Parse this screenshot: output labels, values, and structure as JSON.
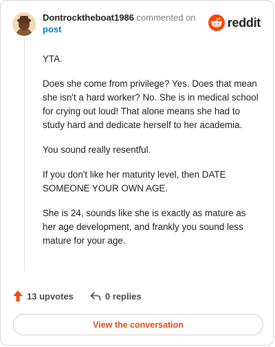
{
  "comment": {
    "username": "Dontrocktheboat1986",
    "commented_on": "commented on",
    "post_link": "post",
    "paragraphs": [
      "YTA.",
      "Does she come from privilege? Yes. Does that mean she isn't a hard worker? No. She is in medical school for crying out loud! That alone means she had to study hard and dedicate herself to her academia.",
      "You sound really resentful.",
      "If you don't like her maturity level, then DATE SOMEONE YOUR OWN AGE.",
      "She is 24, sounds like she is exactly as mature as her age development, and frankly you sound less mature for your age."
    ]
  },
  "brand": {
    "name": "reddit",
    "color": "#ff4500"
  },
  "actions": {
    "upvotes": "13 upvotes",
    "replies": "0 replies"
  },
  "cta": {
    "label": "View the conversation",
    "color": "#e34b12"
  },
  "icons": {
    "avatar": "avatar",
    "brand": "reddit-alien-icon",
    "upvote": "upvote-arrow-icon",
    "reply": "reply-arrow-icon"
  }
}
